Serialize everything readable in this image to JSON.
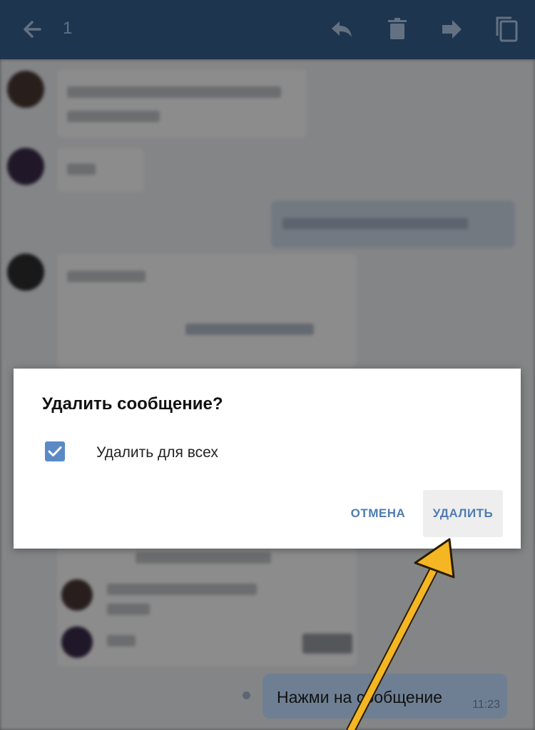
{
  "appbar": {
    "selected_count": "1",
    "icons": [
      "back-arrow-icon",
      "reply-icon",
      "trash-icon",
      "forward-icon",
      "copy-icon"
    ],
    "background": "#2a4a6e"
  },
  "dialog": {
    "title": "Удалить сообщение?",
    "checkbox_label": "Удалить для всех",
    "checkbox_checked": true,
    "cancel_label": "ОТМЕНА",
    "delete_label": "УДАЛИТЬ"
  },
  "last_message": {
    "text": "Нажми на сообщение",
    "time": "11:23"
  },
  "colors": {
    "accent": "#4f7cb0",
    "checkbox": "#5a8ac6",
    "arrow": "#f5b623"
  }
}
